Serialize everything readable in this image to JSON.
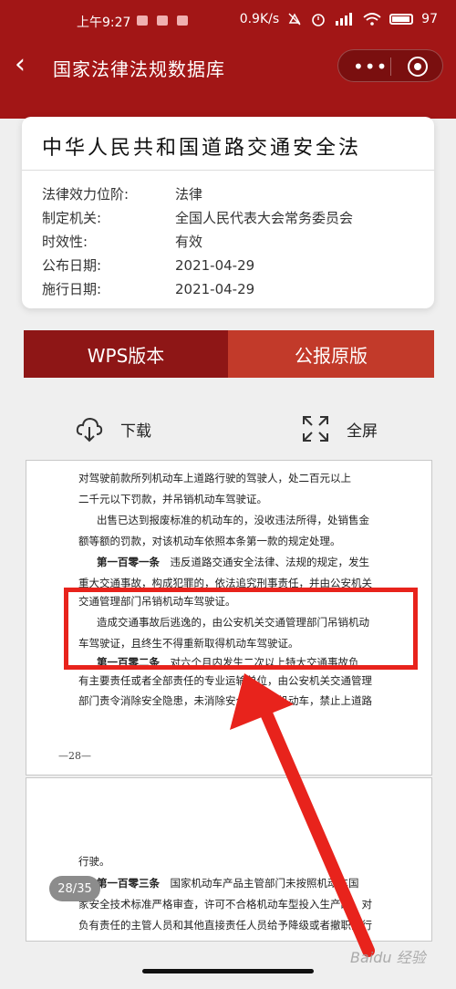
{
  "status": {
    "time": "上午9:27",
    "network": "0.9K/s",
    "battery": "97"
  },
  "nav": {
    "title": "国家法律法规数据库",
    "more_glyph": "•••"
  },
  "law": {
    "title": "中华人民共和国道路交通安全法",
    "rows": [
      {
        "key": "法律效力位阶:",
        "value": "法律"
      },
      {
        "key": "制定机关:",
        "value": "全国人民代表大会常务委员会"
      },
      {
        "key": "时效性:",
        "value": "有效"
      },
      {
        "key": "公布日期:",
        "value": "2021-04-29"
      },
      {
        "key": "施行日期:",
        "value": "2021-04-29"
      }
    ]
  },
  "tabs": {
    "wps": "WPS版本",
    "gazette": "公报原版"
  },
  "toolbar": {
    "download": "下载",
    "fullscreen": "全屏"
  },
  "page1": {
    "lines": [
      "对驾驶前款所列机动车上道路行驶的驾驶人，处二百元以上",
      "二千元以下罚款，并吊销机动车驾驶证。",
      "出售已达到报废标准的机动车的，没收违法所得，处销售金",
      "额等额的罚款，对该机动车依照本条第一款的规定处理。",
      "违反道路交通安全法律、法规的规定，发生",
      "重大交通事故，构成犯罪的，依法追究刑事责任，并由公安机关",
      "交通管理部门吊销机动车驾驶证。",
      "造成交通事故后逃逸的，由公安机关交通管理部门吊销机动",
      "车驾驶证，且终生不得重新取得机动车驾驶证。",
      "对六个月内发生二次以上特大交通事故负",
      "有主要责任或者全部责任的专业运输单位，由公安机关交通管理",
      "部门责令消除安全隐患，未消除安全隐患的机动车，禁止上道路"
    ],
    "article_101": "第一百零一条",
    "article_102": "第一百零二条",
    "page_number": "—28—"
  },
  "page2": {
    "lines": [
      "行驶。",
      "国家机动车产品主管部门未按照机动车国",
      "家安全技术标准严格审查，许可不合格机动车型投入生产的，对",
      "负有责任的主管人员和其他直接责任人员给予降级或者撤职的行"
    ],
    "article_103": "第一百零三条"
  },
  "page_counter": "28/35",
  "watermark": "Baidu 经验",
  "colors": {
    "brand_red": "#a21616",
    "highlight_red": "#e8231c"
  }
}
